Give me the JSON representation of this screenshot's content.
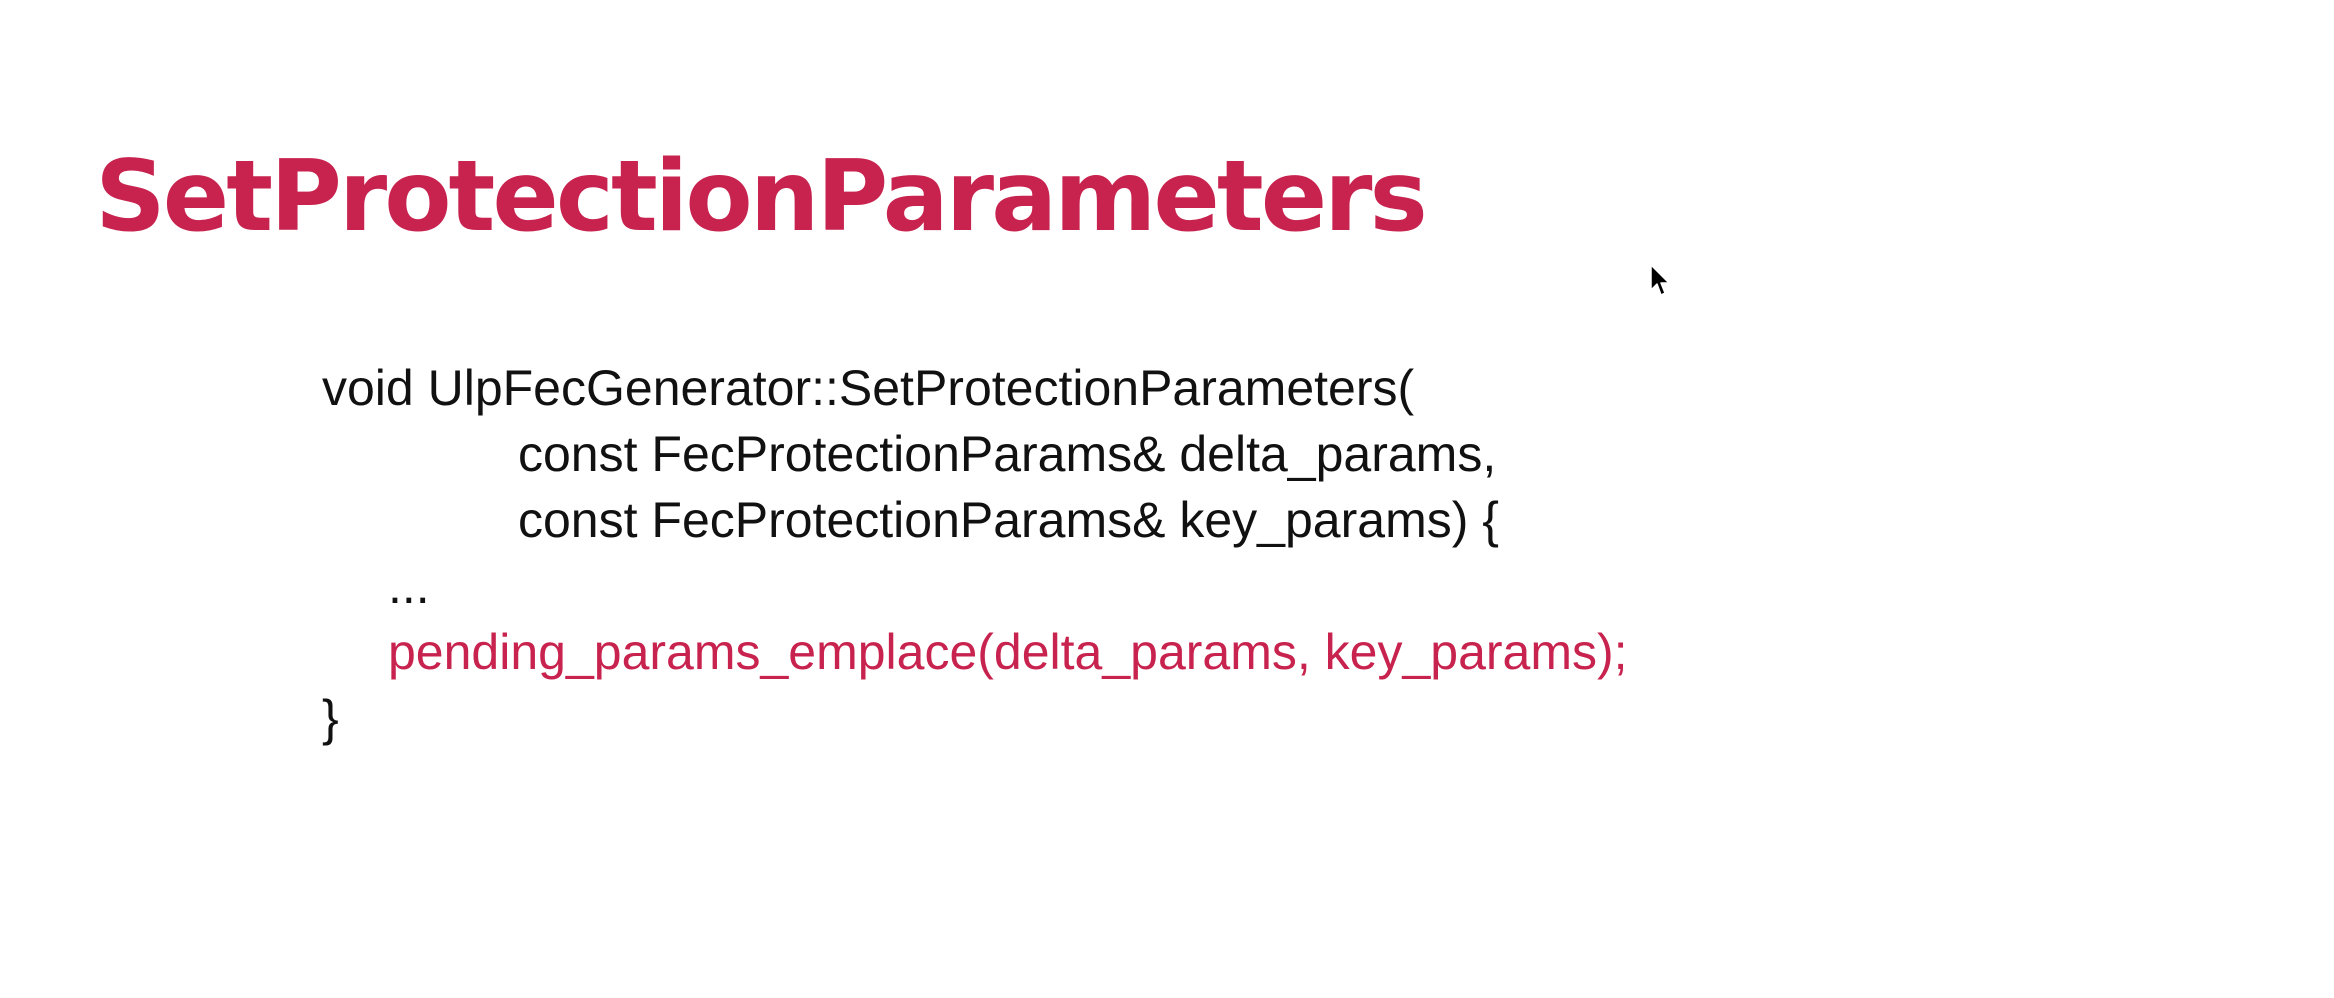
{
  "slide": {
    "title": "SetProtectionParameters",
    "accent_color": "#c8234f",
    "text_color": "#111111",
    "background_color": "#ffffff"
  },
  "code": {
    "lines": [
      "void UlpFecGenerator::SetProtectionParameters(",
      "const FecProtectionParams& delta_params,",
      "const FecProtectionParams& key_params) {",
      "...",
      "pending_params_emplace(delta_params, key_params);",
      "}"
    ]
  },
  "cursor": {
    "icon": "mouse-pointer-icon"
  }
}
